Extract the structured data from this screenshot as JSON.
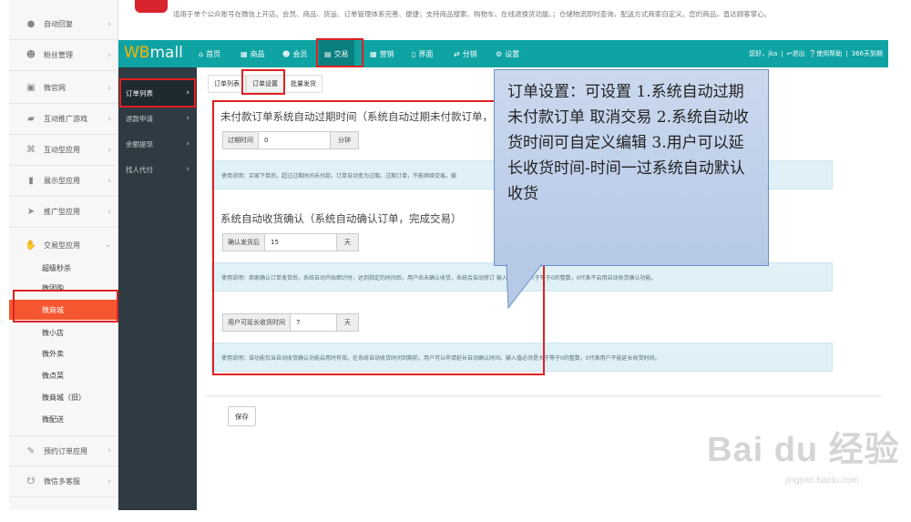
{
  "banner": {
    "description": "适用于单个公众账号在微信上开店。会员、商品、货运、订单管理体系完善、便捷；支持商品搜索、购物车、在线退换货功能、；仓储物流即时查询，配送方式商家自定义。您的商品，直达顾客掌心。"
  },
  "sidebar": {
    "items": [
      {
        "label": "自动回复",
        "icon": "chat-icon"
      },
      {
        "label": "粉丝管理",
        "icon": "users-icon"
      },
      {
        "label": "微官网",
        "icon": "website-icon"
      },
      {
        "label": "互动推广游戏",
        "icon": "gamepad-icon"
      },
      {
        "label": "互动型应用",
        "icon": "command-icon"
      },
      {
        "label": "展示型应用",
        "icon": "book-icon"
      },
      {
        "label": "推广型应用",
        "icon": "share-icon"
      },
      {
        "label": "交易型应用",
        "icon": "hand-icon"
      }
    ],
    "sub_items": [
      "超级秒杀",
      "微团购",
      "微商城",
      "微小店",
      "微外卖",
      "微点菜",
      "微商城（旧）",
      "微配送"
    ],
    "bottom_items": [
      {
        "label": "预约订单应用",
        "icon": "edit-icon"
      },
      {
        "label": "微信多客服",
        "icon": "headset-icon"
      }
    ]
  },
  "navbar": {
    "brand_wb": "WB",
    "brand_mall": "mall",
    "items": [
      "首页",
      "商品",
      "会员",
      "交易",
      "营销",
      "界面",
      "分销",
      "设置"
    ],
    "active": "交易",
    "greeting": "您好，jka",
    "logout": "退出",
    "help": "使用帮助",
    "days": "366天到期"
  },
  "submenu": {
    "items": [
      "订单列表",
      "退款申请",
      "余额提现",
      "找人代付"
    ],
    "active": "订单列表"
  },
  "tabs": [
    "订单列表",
    "订单设置",
    "批量发货"
  ],
  "active_tab": "订单设置",
  "section1": {
    "title": "未付款订单系统自动过期时间（系统自动过期未付款订单，",
    "label": "过期时间",
    "value": "0",
    "unit": "分钟",
    "help": "使用说明：买家下单后，超过过期时间未付款，订单自动变为过期。过期订单，不能继续交易。输"
  },
  "section2": {
    "title": "系统自动收货确认（系统自动确认订单，完成交易）",
    "label": "确认发货后",
    "value": "15",
    "unit": "天",
    "help": "使用说明：商家确认订单发货后，系统自动开始倒计时，达到指定的时间后，用户尚未确认收货，系统会自动将订                                                      输入值必须是大于等于0的整数，0代表不启用自动收货确认功能。"
  },
  "section3": {
    "label": "用户可延长收货时间",
    "value": "7",
    "unit": "天",
    "help": "使用说明：该功能仅当自动收货确认功能启用时有效。在系统自动收货时间到期前，用户可以申请延长自动确认时间。输入值必须是大于等于0的整数，0代表用户不能延长收货时间。"
  },
  "save_label": "保存",
  "callout": {
    "text": "订单设置：可设置 1.系统自动过期未付款订单  取消交易 2.系统自动收货时间可自定义编辑 3.用户可以延长收货时间-时间一过系统自动默认收货"
  },
  "watermark": {
    "big": "Bai du 经验",
    "small": "jingyan.baidu.com"
  },
  "colors": {
    "nav": "#0fa3a3",
    "active_sub": "#f4572f",
    "annotation": "#e02020",
    "callout_fill": "#b6c9e6"
  }
}
